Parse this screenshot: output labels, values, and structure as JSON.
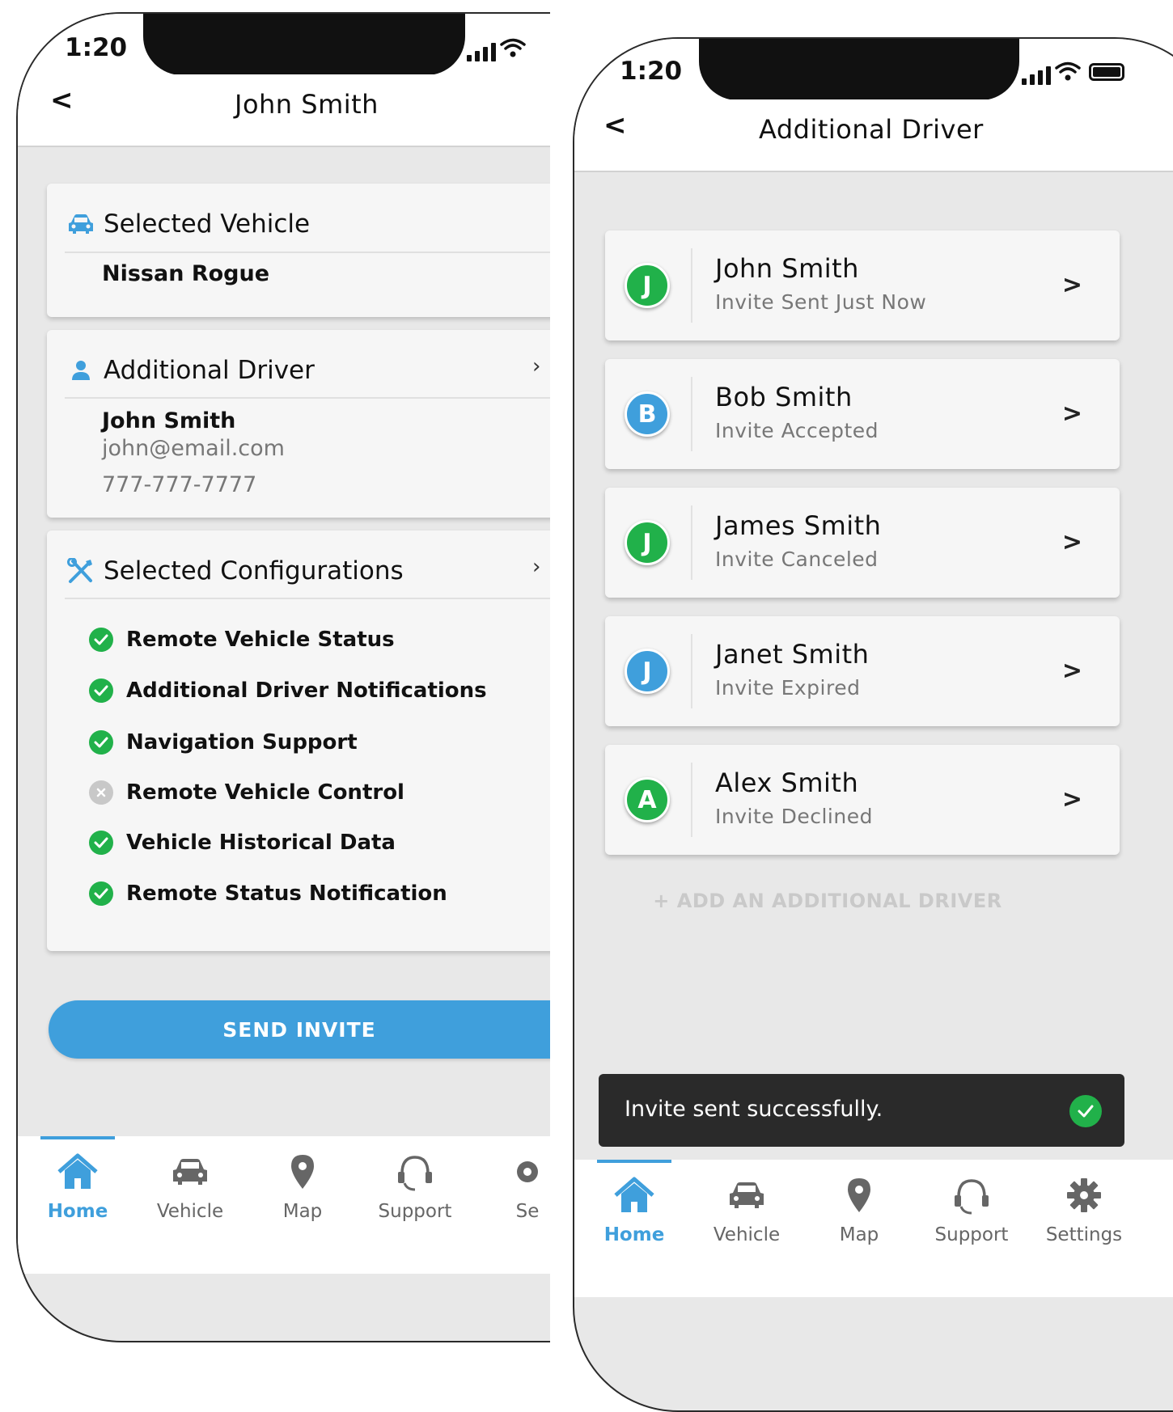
{
  "left_screen": {
    "status_time": "1:20",
    "nav_title": "John Smith",
    "back_glyph": "<",
    "selected_vehicle": {
      "heading": "Selected Vehicle",
      "icon": "car-icon",
      "value": "Nissan Rogue"
    },
    "additional_driver": {
      "heading": "Additional Driver",
      "icon": "person-icon",
      "name": "John Smith",
      "email": "john@email.com",
      "phone": "777-777-7777"
    },
    "selected_configurations": {
      "heading": "Selected Configurations",
      "icon": "tools-icon",
      "items": [
        {
          "label": "Remote Vehicle Status",
          "enabled": true
        },
        {
          "label": "Additional Driver Notifications",
          "enabled": true
        },
        {
          "label": "Navigation Support",
          "enabled": true
        },
        {
          "label": "Remote Vehicle Control",
          "enabled": false
        },
        {
          "label": "Vehicle Historical Data",
          "enabled": true
        },
        {
          "label": "Remote Status Notification",
          "enabled": true
        }
      ]
    },
    "send_invite_label": "SEND INVITE",
    "tabs": [
      {
        "label": "Home",
        "icon": "home-icon",
        "active": true
      },
      {
        "label": "Vehicle",
        "icon": "car-icon",
        "active": false
      },
      {
        "label": "Map",
        "icon": "map-pin-icon",
        "active": false
      },
      {
        "label": "Support",
        "icon": "headset-icon",
        "active": false
      },
      {
        "label": "Se",
        "icon": "gear-icon",
        "active": false
      }
    ]
  },
  "right_screen": {
    "status_time": "1:20",
    "nav_title": "Additional Driver",
    "back_glyph": "<",
    "drivers": [
      {
        "initial": "J",
        "name": "John Smith",
        "status": "Invite Sent Just Now",
        "avatar_color": "#21b14a"
      },
      {
        "initial": "B",
        "name": "Bob Smith",
        "status": "Invite Accepted",
        "avatar_color": "#3f9fdc"
      },
      {
        "initial": "J",
        "name": "James Smith",
        "status": "Invite Canceled",
        "avatar_color": "#21b14a"
      },
      {
        "initial": "J",
        "name": "Janet Smith",
        "status": "Invite Expired",
        "avatar_color": "#3f9fdc"
      },
      {
        "initial": "A",
        "name": "Alex Smith",
        "status": "Invite Declined",
        "avatar_color": "#21b14a"
      }
    ],
    "chevron_glyph": ">",
    "add_driver_label": "+ ADD AN ADDITIONAL DRIVER",
    "toast_message": "Invite sent successfully.",
    "tabs": [
      {
        "label": "Home",
        "icon": "home-icon",
        "active": true
      },
      {
        "label": "Vehicle",
        "icon": "car-icon",
        "active": false
      },
      {
        "label": "Map",
        "icon": "map-pin-icon",
        "active": false
      },
      {
        "label": "Support",
        "icon": "headset-icon",
        "active": false
      },
      {
        "label": "Settings",
        "icon": "gear-icon",
        "active": false
      }
    ]
  },
  "colors": {
    "accent_blue": "#3f9fdc",
    "success_green": "#21b14a",
    "disabled_gray": "#c8c8c8",
    "toast_bg": "#2a2a2a"
  }
}
